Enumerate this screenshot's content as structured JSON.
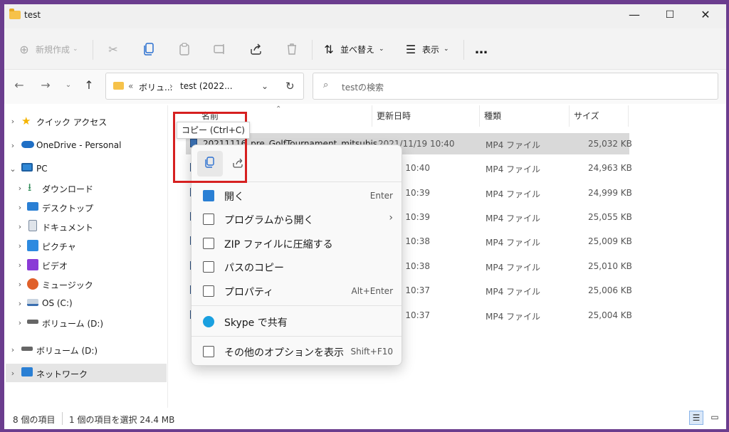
{
  "window": {
    "title": "test"
  },
  "window_controls": {
    "minimize": "—",
    "maximize": "☐",
    "close": "✕"
  },
  "toolbar": {
    "new_label": "新規作成",
    "sort_label": "並べ替え",
    "view_label": "表示",
    "more": "…"
  },
  "address": {
    "overflow": "«",
    "crumb1": "ボリュ...",
    "sep": "›",
    "crumb2": "test (2022...",
    "search_placeholder": "testの検索"
  },
  "sidebar": {
    "items": [
      {
        "label": "クイック アクセス",
        "icon": "star-icon",
        "color": "#f5b400"
      },
      {
        "label": "OneDrive - Personal",
        "icon": "cloud-icon",
        "color": "#1f6fc5"
      },
      {
        "label": "PC",
        "icon": "pc-icon",
        "color": "#2f88d6"
      },
      {
        "label": "ダウンロード",
        "icon": "download-icon",
        "color": "#2e8b57"
      },
      {
        "label": "デスクトップ",
        "icon": "desktop-icon",
        "color": "#2a7fd4"
      },
      {
        "label": "ドキュメント",
        "icon": "document-icon",
        "color": "#7a8aa0"
      },
      {
        "label": "ピクチャ",
        "icon": "pictures-icon",
        "color": "#2d8ae0"
      },
      {
        "label": "ビデオ",
        "icon": "video-icon",
        "color": "#8a3ad6"
      },
      {
        "label": "ミュージック",
        "icon": "music-icon",
        "color": "#e0602a"
      },
      {
        "label": "OS (C:)",
        "icon": "os-drive-icon",
        "color": "#3a6fb0"
      },
      {
        "label": "ボリューム (D:)",
        "icon": "drive-icon",
        "color": "#666666"
      },
      {
        "label": "ボリューム (D:)",
        "icon": "drive-icon",
        "color": "#666666"
      },
      {
        "label": "ネットワーク",
        "icon": "network-icon",
        "color": "#2a7fd4"
      }
    ]
  },
  "columns": {
    "name": "名前",
    "date": "更新日時",
    "type": "種類",
    "size": "サイズ"
  },
  "files": [
    {
      "name": "20211116_pre_GolfTournament_mitsubis",
      "date": "2021/11/19 10:40",
      "type": "MP4 ファイル",
      "size": "25,032 KB"
    },
    {
      "name": "",
      "date": "11/19 10:40",
      "type": "MP4 ファイル",
      "size": "24,963 KB"
    },
    {
      "name": "",
      "date": "11/19 10:39",
      "type": "MP4 ファイル",
      "size": "24,999 KB"
    },
    {
      "name": "",
      "date": "11/19 10:39",
      "type": "MP4 ファイル",
      "size": "25,055 KB"
    },
    {
      "name": "",
      "date": "11/19 10:38",
      "type": "MP4 ファイル",
      "size": "25,009 KB"
    },
    {
      "name": "",
      "date": "11/19 10:38",
      "type": "MP4 ファイル",
      "size": "25,010 KB"
    },
    {
      "name": "",
      "date": "11/19 10:37",
      "type": "MP4 ファイル",
      "size": "25,006 KB"
    },
    {
      "name": "",
      "date": "11/19 10:37",
      "type": "MP4 ファイル",
      "size": "25,004 KB"
    }
  ],
  "context_menu": {
    "items": [
      {
        "label": "開く",
        "shortcut": "Enter",
        "icon": "photo-icon"
      },
      {
        "label": "プログラムから開く",
        "shortcut": "›",
        "icon": "open-with-icon"
      },
      {
        "label": "ZIP ファイルに圧縮する",
        "shortcut": "",
        "icon": "zip-icon"
      },
      {
        "label": "パスのコピー",
        "shortcut": "",
        "icon": "copy-path-icon"
      },
      {
        "label": "プロパティ",
        "shortcut": "Alt+Enter",
        "icon": "properties-icon"
      },
      {
        "label": "Skype で共有",
        "shortcut": "",
        "icon": "skype-icon"
      },
      {
        "label": "その他のオプションを表示",
        "shortcut": "Shift+F10",
        "icon": "more-options-icon"
      }
    ]
  },
  "tooltip": {
    "text": "コピー (Ctrl+C)"
  },
  "status": {
    "count": "8 個の項目",
    "selected": "1 個の項目を選択 24.4 MB"
  }
}
